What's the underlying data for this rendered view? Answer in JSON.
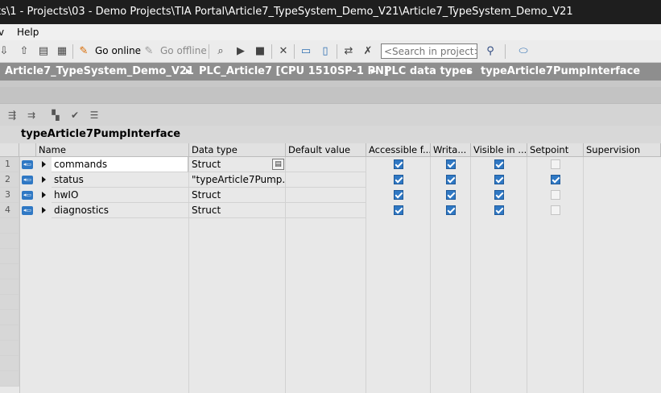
{
  "window": {
    "title": "ts\\1 - Projects\\03 - Demo Projects\\TIA Portal\\Article7_TypeSystem_Demo_V21\\Article7_TypeSystem_Demo_V21"
  },
  "menu": {
    "items": [
      {
        "label": "v"
      },
      {
        "label": "Help"
      }
    ]
  },
  "toolbar": {
    "go_online": "Go online",
    "go_offline": "Go offline",
    "search_placeholder": "<Search in project>",
    "icons": [
      "download-icon",
      "upload-icon",
      "download-to-device-icon",
      "runtime-icon",
      "go-online-icon",
      "go-offline-icon",
      "accessible-devices-icon",
      "start-simulation-icon",
      "stop-simulation-icon",
      "close-icon",
      "split-horizontal-icon",
      "split-vertical-icon",
      "compare-icon",
      "cross-reference-icon",
      "search-binoculars-icon",
      "portal-icon"
    ]
  },
  "breadcrumb": {
    "items": [
      "Article7_TypeSystem_Demo_V21",
      "PLC_Article7 [CPU 1510SP-1 PN]",
      "PLC data types",
      "typeArticle7PumpInterface"
    ],
    "separator": "▸"
  },
  "editor": {
    "block_title": "typeArticle7PumpInterface",
    "columns": [
      "Name",
      "Data type",
      "Default value",
      "Accessible f...",
      "Writa...",
      "Visible in ...",
      "Setpoint",
      "Supervision"
    ],
    "rows": [
      {
        "num": "1",
        "name": "commands",
        "data_type": "Struct",
        "default_value": "",
        "accessible": true,
        "writable": true,
        "visible": true,
        "setpoint": false,
        "setpoint_enabled": false,
        "supervision": ""
      },
      {
        "num": "2",
        "name": "status",
        "data_type": "\"typeArticle7Pump...",
        "default_value": "",
        "accessible": true,
        "writable": true,
        "visible": true,
        "setpoint": true,
        "setpoint_enabled": true,
        "supervision": ""
      },
      {
        "num": "3",
        "name": "hwIO",
        "data_type": "Struct",
        "default_value": "",
        "accessible": true,
        "writable": true,
        "visible": true,
        "setpoint": false,
        "setpoint_enabled": false,
        "supervision": ""
      },
      {
        "num": "4",
        "name": "diagnostics",
        "data_type": "Struct",
        "default_value": "",
        "accessible": true,
        "writable": true,
        "visible": true,
        "setpoint": false,
        "setpoint_enabled": false,
        "supervision": ""
      }
    ]
  }
}
